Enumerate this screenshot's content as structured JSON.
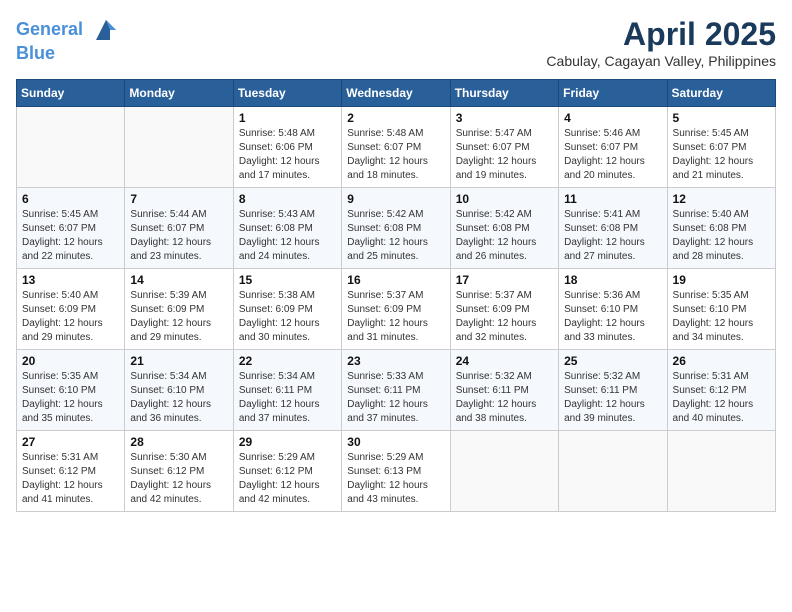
{
  "header": {
    "logo_line1": "General",
    "logo_line2": "Blue",
    "month_year": "April 2025",
    "location": "Cabulay, Cagayan Valley, Philippines"
  },
  "weekdays": [
    "Sunday",
    "Monday",
    "Tuesday",
    "Wednesday",
    "Thursday",
    "Friday",
    "Saturday"
  ],
  "weeks": [
    [
      {
        "day": "",
        "info": ""
      },
      {
        "day": "",
        "info": ""
      },
      {
        "day": "1",
        "info": "Sunrise: 5:48 AM\nSunset: 6:06 PM\nDaylight: 12 hours and 17 minutes."
      },
      {
        "day": "2",
        "info": "Sunrise: 5:48 AM\nSunset: 6:07 PM\nDaylight: 12 hours and 18 minutes."
      },
      {
        "day": "3",
        "info": "Sunrise: 5:47 AM\nSunset: 6:07 PM\nDaylight: 12 hours and 19 minutes."
      },
      {
        "day": "4",
        "info": "Sunrise: 5:46 AM\nSunset: 6:07 PM\nDaylight: 12 hours and 20 minutes."
      },
      {
        "day": "5",
        "info": "Sunrise: 5:45 AM\nSunset: 6:07 PM\nDaylight: 12 hours and 21 minutes."
      }
    ],
    [
      {
        "day": "6",
        "info": "Sunrise: 5:45 AM\nSunset: 6:07 PM\nDaylight: 12 hours and 22 minutes."
      },
      {
        "day": "7",
        "info": "Sunrise: 5:44 AM\nSunset: 6:07 PM\nDaylight: 12 hours and 23 minutes."
      },
      {
        "day": "8",
        "info": "Sunrise: 5:43 AM\nSunset: 6:08 PM\nDaylight: 12 hours and 24 minutes."
      },
      {
        "day": "9",
        "info": "Sunrise: 5:42 AM\nSunset: 6:08 PM\nDaylight: 12 hours and 25 minutes."
      },
      {
        "day": "10",
        "info": "Sunrise: 5:42 AM\nSunset: 6:08 PM\nDaylight: 12 hours and 26 minutes."
      },
      {
        "day": "11",
        "info": "Sunrise: 5:41 AM\nSunset: 6:08 PM\nDaylight: 12 hours and 27 minutes."
      },
      {
        "day": "12",
        "info": "Sunrise: 5:40 AM\nSunset: 6:08 PM\nDaylight: 12 hours and 28 minutes."
      }
    ],
    [
      {
        "day": "13",
        "info": "Sunrise: 5:40 AM\nSunset: 6:09 PM\nDaylight: 12 hours and 29 minutes."
      },
      {
        "day": "14",
        "info": "Sunrise: 5:39 AM\nSunset: 6:09 PM\nDaylight: 12 hours and 29 minutes."
      },
      {
        "day": "15",
        "info": "Sunrise: 5:38 AM\nSunset: 6:09 PM\nDaylight: 12 hours and 30 minutes."
      },
      {
        "day": "16",
        "info": "Sunrise: 5:37 AM\nSunset: 6:09 PM\nDaylight: 12 hours and 31 minutes."
      },
      {
        "day": "17",
        "info": "Sunrise: 5:37 AM\nSunset: 6:09 PM\nDaylight: 12 hours and 32 minutes."
      },
      {
        "day": "18",
        "info": "Sunrise: 5:36 AM\nSunset: 6:10 PM\nDaylight: 12 hours and 33 minutes."
      },
      {
        "day": "19",
        "info": "Sunrise: 5:35 AM\nSunset: 6:10 PM\nDaylight: 12 hours and 34 minutes."
      }
    ],
    [
      {
        "day": "20",
        "info": "Sunrise: 5:35 AM\nSunset: 6:10 PM\nDaylight: 12 hours and 35 minutes."
      },
      {
        "day": "21",
        "info": "Sunrise: 5:34 AM\nSunset: 6:10 PM\nDaylight: 12 hours and 36 minutes."
      },
      {
        "day": "22",
        "info": "Sunrise: 5:34 AM\nSunset: 6:11 PM\nDaylight: 12 hours and 37 minutes."
      },
      {
        "day": "23",
        "info": "Sunrise: 5:33 AM\nSunset: 6:11 PM\nDaylight: 12 hours and 37 minutes."
      },
      {
        "day": "24",
        "info": "Sunrise: 5:32 AM\nSunset: 6:11 PM\nDaylight: 12 hours and 38 minutes."
      },
      {
        "day": "25",
        "info": "Sunrise: 5:32 AM\nSunset: 6:11 PM\nDaylight: 12 hours and 39 minutes."
      },
      {
        "day": "26",
        "info": "Sunrise: 5:31 AM\nSunset: 6:12 PM\nDaylight: 12 hours and 40 minutes."
      }
    ],
    [
      {
        "day": "27",
        "info": "Sunrise: 5:31 AM\nSunset: 6:12 PM\nDaylight: 12 hours and 41 minutes."
      },
      {
        "day": "28",
        "info": "Sunrise: 5:30 AM\nSunset: 6:12 PM\nDaylight: 12 hours and 42 minutes."
      },
      {
        "day": "29",
        "info": "Sunrise: 5:29 AM\nSunset: 6:12 PM\nDaylight: 12 hours and 42 minutes."
      },
      {
        "day": "30",
        "info": "Sunrise: 5:29 AM\nSunset: 6:13 PM\nDaylight: 12 hours and 43 minutes."
      },
      {
        "day": "",
        "info": ""
      },
      {
        "day": "",
        "info": ""
      },
      {
        "day": "",
        "info": ""
      }
    ]
  ]
}
